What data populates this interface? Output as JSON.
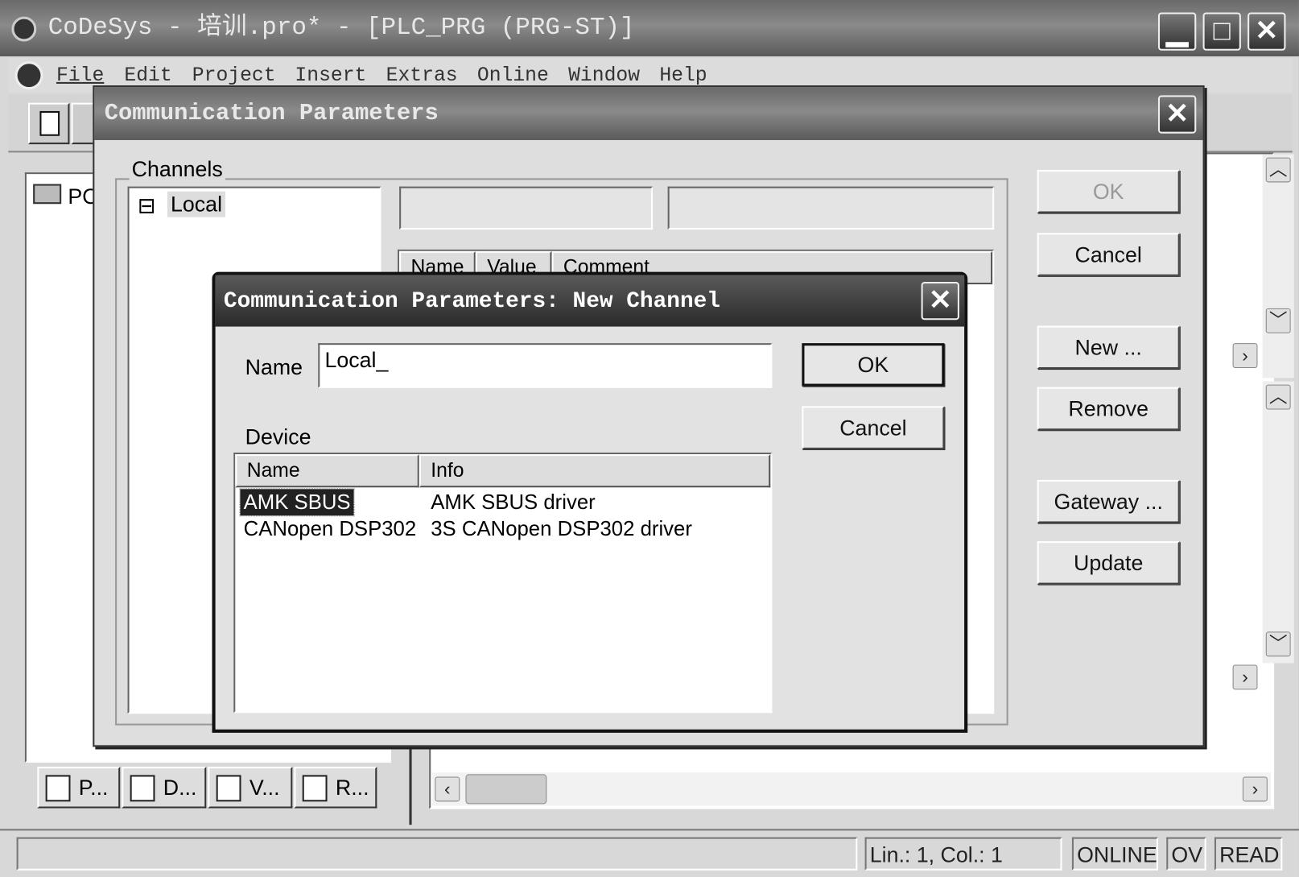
{
  "window": {
    "title": "CoDeSys - 培训.pro* - [PLC_PRG (PRG-ST)]",
    "min": "▁",
    "max": "□",
    "close": "✕"
  },
  "menu": {
    "items": [
      "File",
      "Edit",
      "Project",
      "Insert",
      "Extras",
      "Online",
      "Window",
      "Help"
    ]
  },
  "left_panel": {
    "tree_root": "PO",
    "tabs": [
      "P...",
      "D...",
      "V...",
      "R..."
    ]
  },
  "status": {
    "position": "Lin.: 1, Col.: 1",
    "online": "ONLINE",
    "ov": "OV",
    "read": "READ"
  },
  "comm_dialog": {
    "title": "Communication Parameters",
    "channels_label": "Channels",
    "tree": [
      {
        "label": "Local",
        "expander": "⊟"
      }
    ],
    "table_headers": [
      "Name",
      "Value",
      "Comment"
    ],
    "buttons": {
      "ok": "OK",
      "cancel": "Cancel",
      "new": "New ...",
      "remove": "Remove",
      "gateway": "Gateway ...",
      "update": "Update"
    }
  },
  "new_channel_dialog": {
    "title": "Communication Parameters: New Channel",
    "name_label": "Name",
    "name_value": "Local_",
    "device_label": "Device",
    "ok": "OK",
    "cancel": "Cancel",
    "columns": [
      "Name",
      "Info"
    ],
    "devices": [
      {
        "name": "AMK SBUS",
        "info": "AMK SBUS driver",
        "selected": true
      },
      {
        "name": "CANopen DSP302",
        "info": "3S CANopen DSP302 driver",
        "selected": false
      }
    ]
  }
}
